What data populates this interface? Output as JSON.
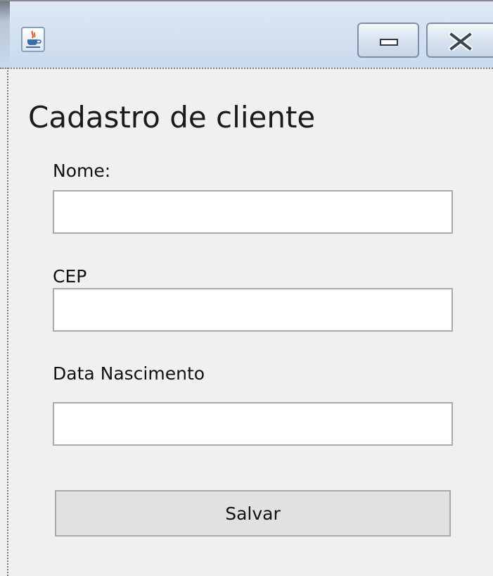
{
  "window": {
    "icon": "java-cup-icon",
    "controls": {
      "minimize_icon": "minimize-icon",
      "close_icon": "close-icon"
    }
  },
  "form": {
    "heading": "Cadastro de cliente",
    "fields": [
      {
        "label": "Nome:",
        "value": ""
      },
      {
        "label": "CEP",
        "value": ""
      },
      {
        "label": "Data Nascimento",
        "value": ""
      }
    ],
    "save_label": "Salvar"
  },
  "colors": {
    "window_background": "#f0f0f0",
    "titlebar": "#c9d9ec",
    "field_border": "#aaaaaa",
    "button_background": "#e1e1e1"
  }
}
